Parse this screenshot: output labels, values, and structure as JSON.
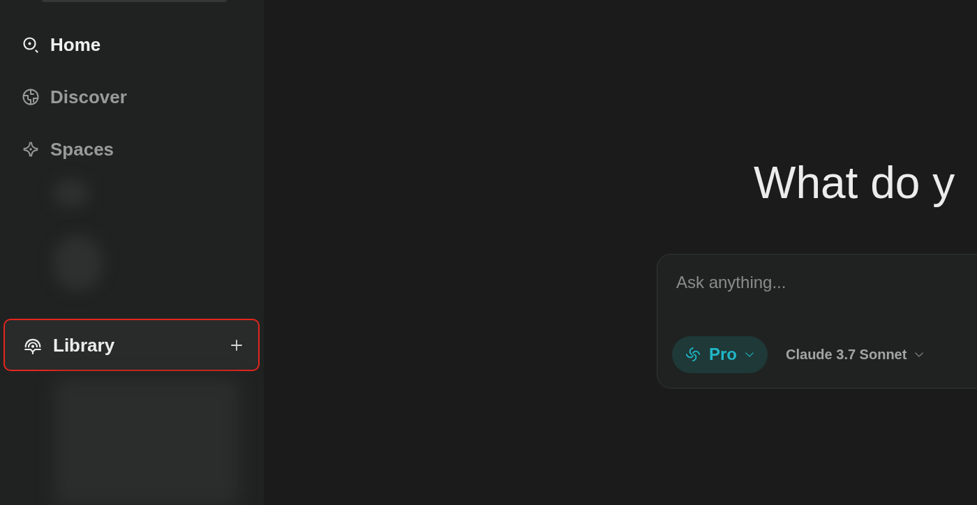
{
  "sidebar": {
    "nav": [
      {
        "label": "Home",
        "selected": true
      },
      {
        "label": "Discover",
        "selected": false
      },
      {
        "label": "Spaces",
        "selected": false
      }
    ],
    "library": {
      "label": "Library",
      "highlighted": true
    }
  },
  "main": {
    "heading": "What do y",
    "composer": {
      "placeholder": "Ask anything...",
      "mode": {
        "label": "Pro",
        "on": true
      },
      "model": {
        "label": "Claude 3.7 Sonnet"
      }
    }
  }
}
